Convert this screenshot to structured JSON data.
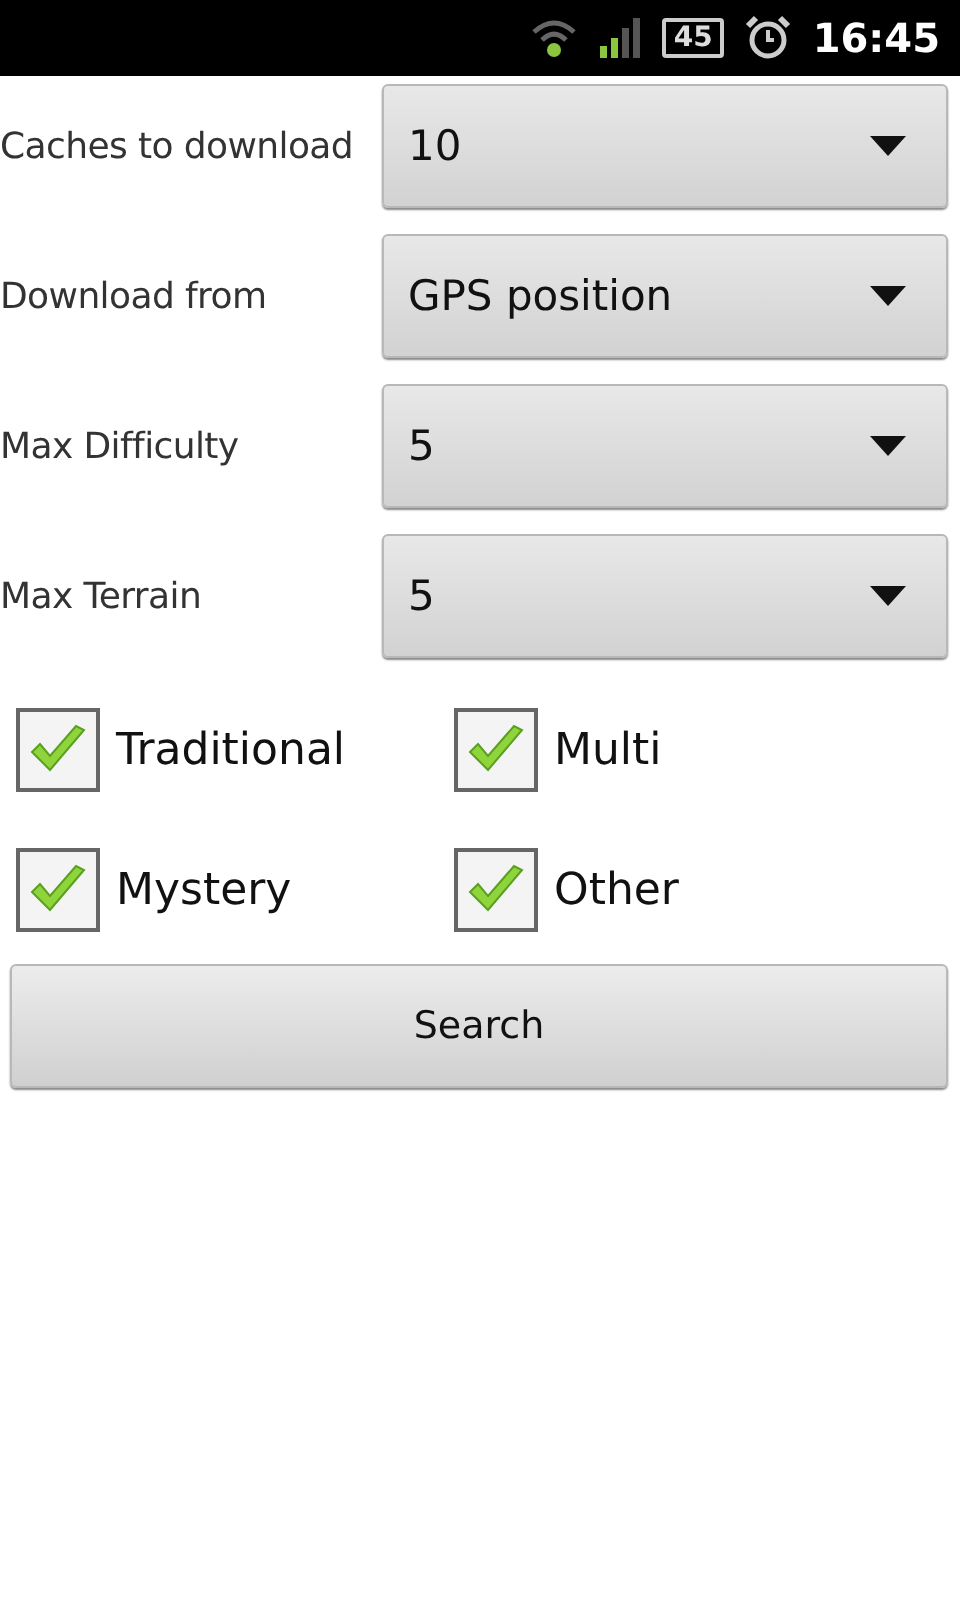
{
  "status_bar": {
    "battery": "45",
    "time": "16:45"
  },
  "fields": [
    {
      "label": "Caches to download",
      "value": "10"
    },
    {
      "label": "Download from",
      "value": "GPS position"
    },
    {
      "label": "Max Difficulty",
      "value": "5"
    },
    {
      "label": "Max Terrain",
      "value": "5"
    }
  ],
  "cache_types": [
    {
      "label": "Traditional",
      "checked": true
    },
    {
      "label": "Multi",
      "checked": true
    },
    {
      "label": "Mystery",
      "checked": true
    },
    {
      "label": "Other",
      "checked": true
    }
  ],
  "search_button": "Search"
}
